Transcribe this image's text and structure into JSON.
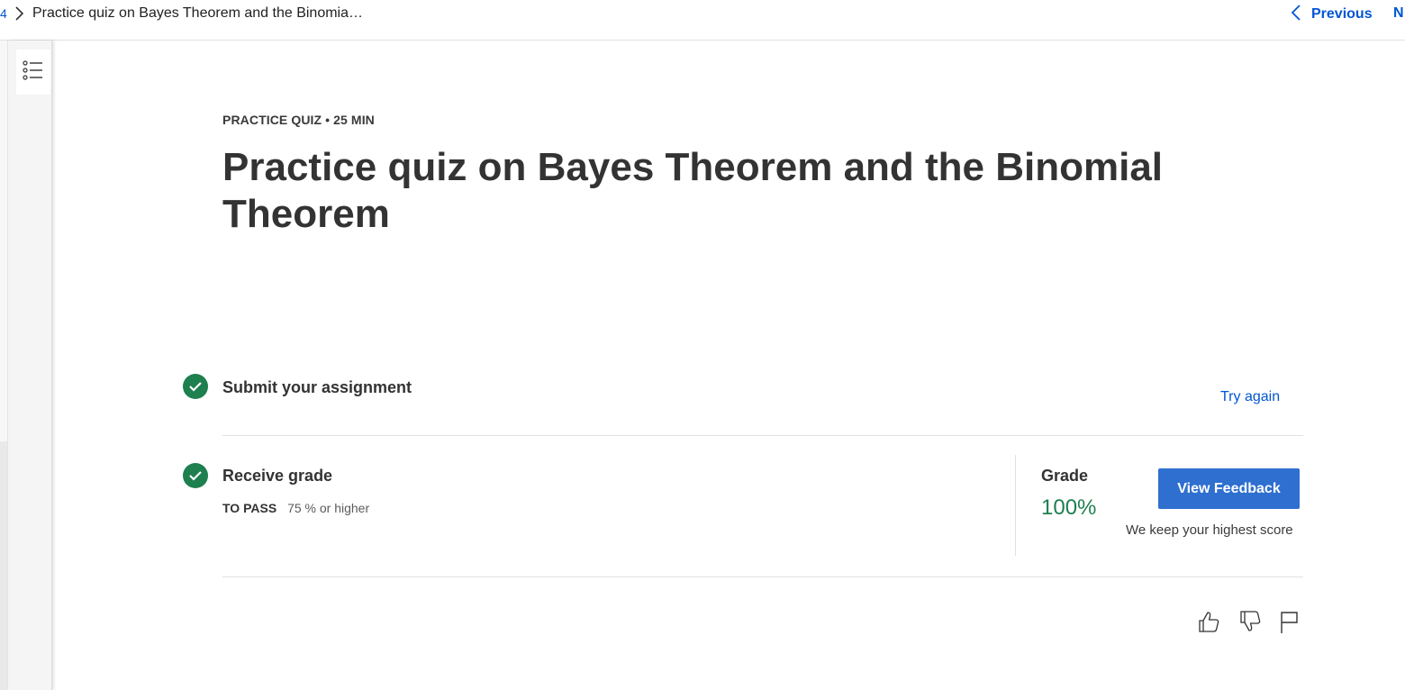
{
  "breadcrumb": {
    "number": "4",
    "title": "Practice quiz on Bayes Theorem and the Binomia…"
  },
  "nav": {
    "previous_label": "Previous",
    "next_label": "N"
  },
  "header": {
    "eyebrow": "PRACTICE QUIZ • 25 MIN",
    "title": "Practice quiz on Bayes Theorem and the Binomial Theorem"
  },
  "steps": {
    "submit_label": "Submit your assignment",
    "try_again_label": "Try again",
    "receive_label": "Receive grade",
    "to_pass_label": "TO PASS",
    "to_pass_value": "75 % or higher"
  },
  "grade": {
    "label": "Grade",
    "value": "100%",
    "feedback_button": "View Feedback",
    "note": "We keep your highest score"
  },
  "colors": {
    "accent_blue": "#0056d2",
    "success_green": "#1e7f4f",
    "button_blue": "#2e6fcf"
  },
  "icons": [
    "chevron-right-icon",
    "chevron-left-icon",
    "list-menu-icon",
    "check-icon",
    "thumbs-up-icon",
    "thumbs-down-icon",
    "flag-icon"
  ]
}
